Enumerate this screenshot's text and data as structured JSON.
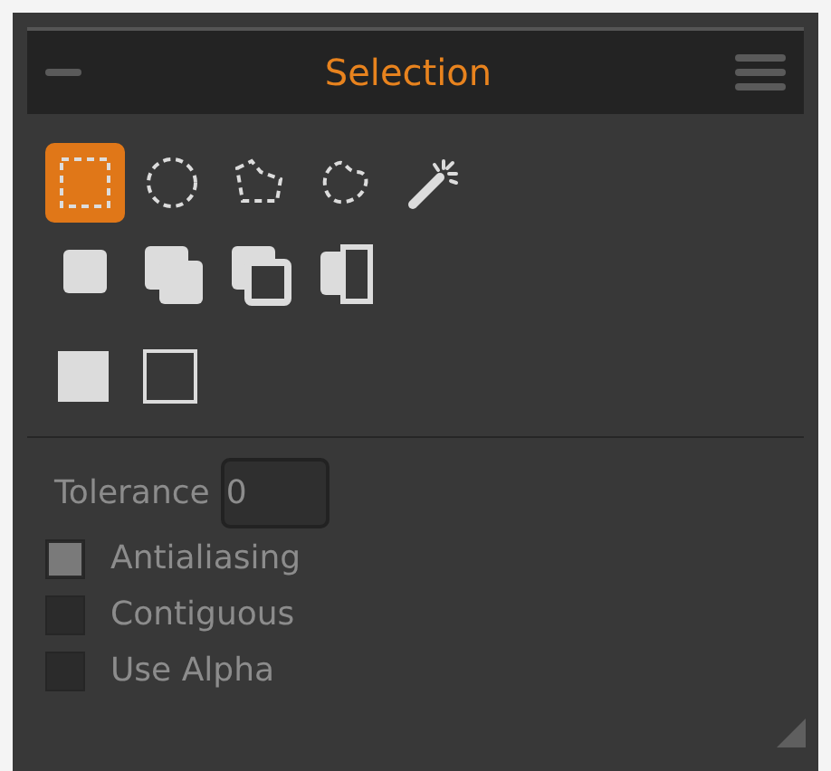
{
  "panel": {
    "title": "Selection"
  },
  "tools": [
    {
      "kind": "rect",
      "selected": true
    },
    {
      "kind": "ellipse",
      "selected": false
    },
    {
      "kind": "polygon",
      "selected": false
    },
    {
      "kind": "freehand",
      "selected": false
    },
    {
      "kind": "wand",
      "selected": false
    }
  ],
  "modes": [
    {
      "kind": "replace"
    },
    {
      "kind": "add"
    },
    {
      "kind": "subtract"
    },
    {
      "kind": "intersect"
    }
  ],
  "fills": [
    {
      "kind": "filled"
    },
    {
      "kind": "outline"
    }
  ],
  "tolerance": {
    "label": "Tolerance",
    "value": "0"
  },
  "options": [
    {
      "label": "Antialiasing",
      "checked": true
    },
    {
      "label": "Contiguous",
      "checked": false
    },
    {
      "label": "Use Alpha",
      "checked": false
    }
  ]
}
